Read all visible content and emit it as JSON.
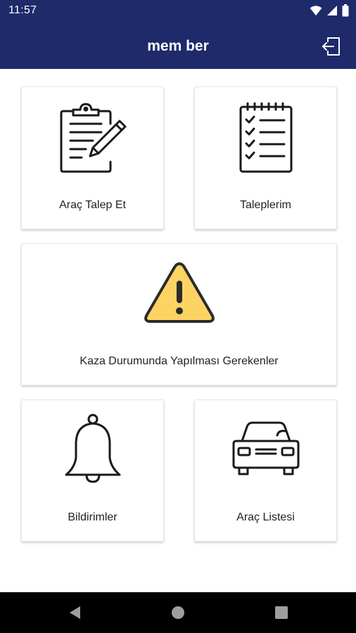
{
  "status_bar": {
    "time": "11:57",
    "icons": [
      "wifi-icon",
      "signal-icon",
      "battery-icon"
    ]
  },
  "app_bar": {
    "title": "mem ber",
    "logout_icon": "logout-icon"
  },
  "cards": {
    "request_vehicle": {
      "label": "Araç Talep Et",
      "icon": "clipboard-edit-icon"
    },
    "my_requests": {
      "label": "Taleplerim",
      "icon": "checklist-icon"
    },
    "accident": {
      "label": "Kaza Durumunda Yapılması Gerekenler",
      "icon": "warning-icon"
    },
    "notifications": {
      "label": "Bildirimler",
      "icon": "bell-icon"
    },
    "vehicle_list": {
      "label": "Araç Listesi",
      "icon": "car-icon"
    }
  },
  "nav_bar": {
    "buttons": [
      "back-icon",
      "home-icon",
      "recents-icon"
    ]
  },
  "colors": {
    "primary": "#1f2a6b",
    "warning": "#fdd463",
    "icon_stroke": "#1a1a1a"
  }
}
